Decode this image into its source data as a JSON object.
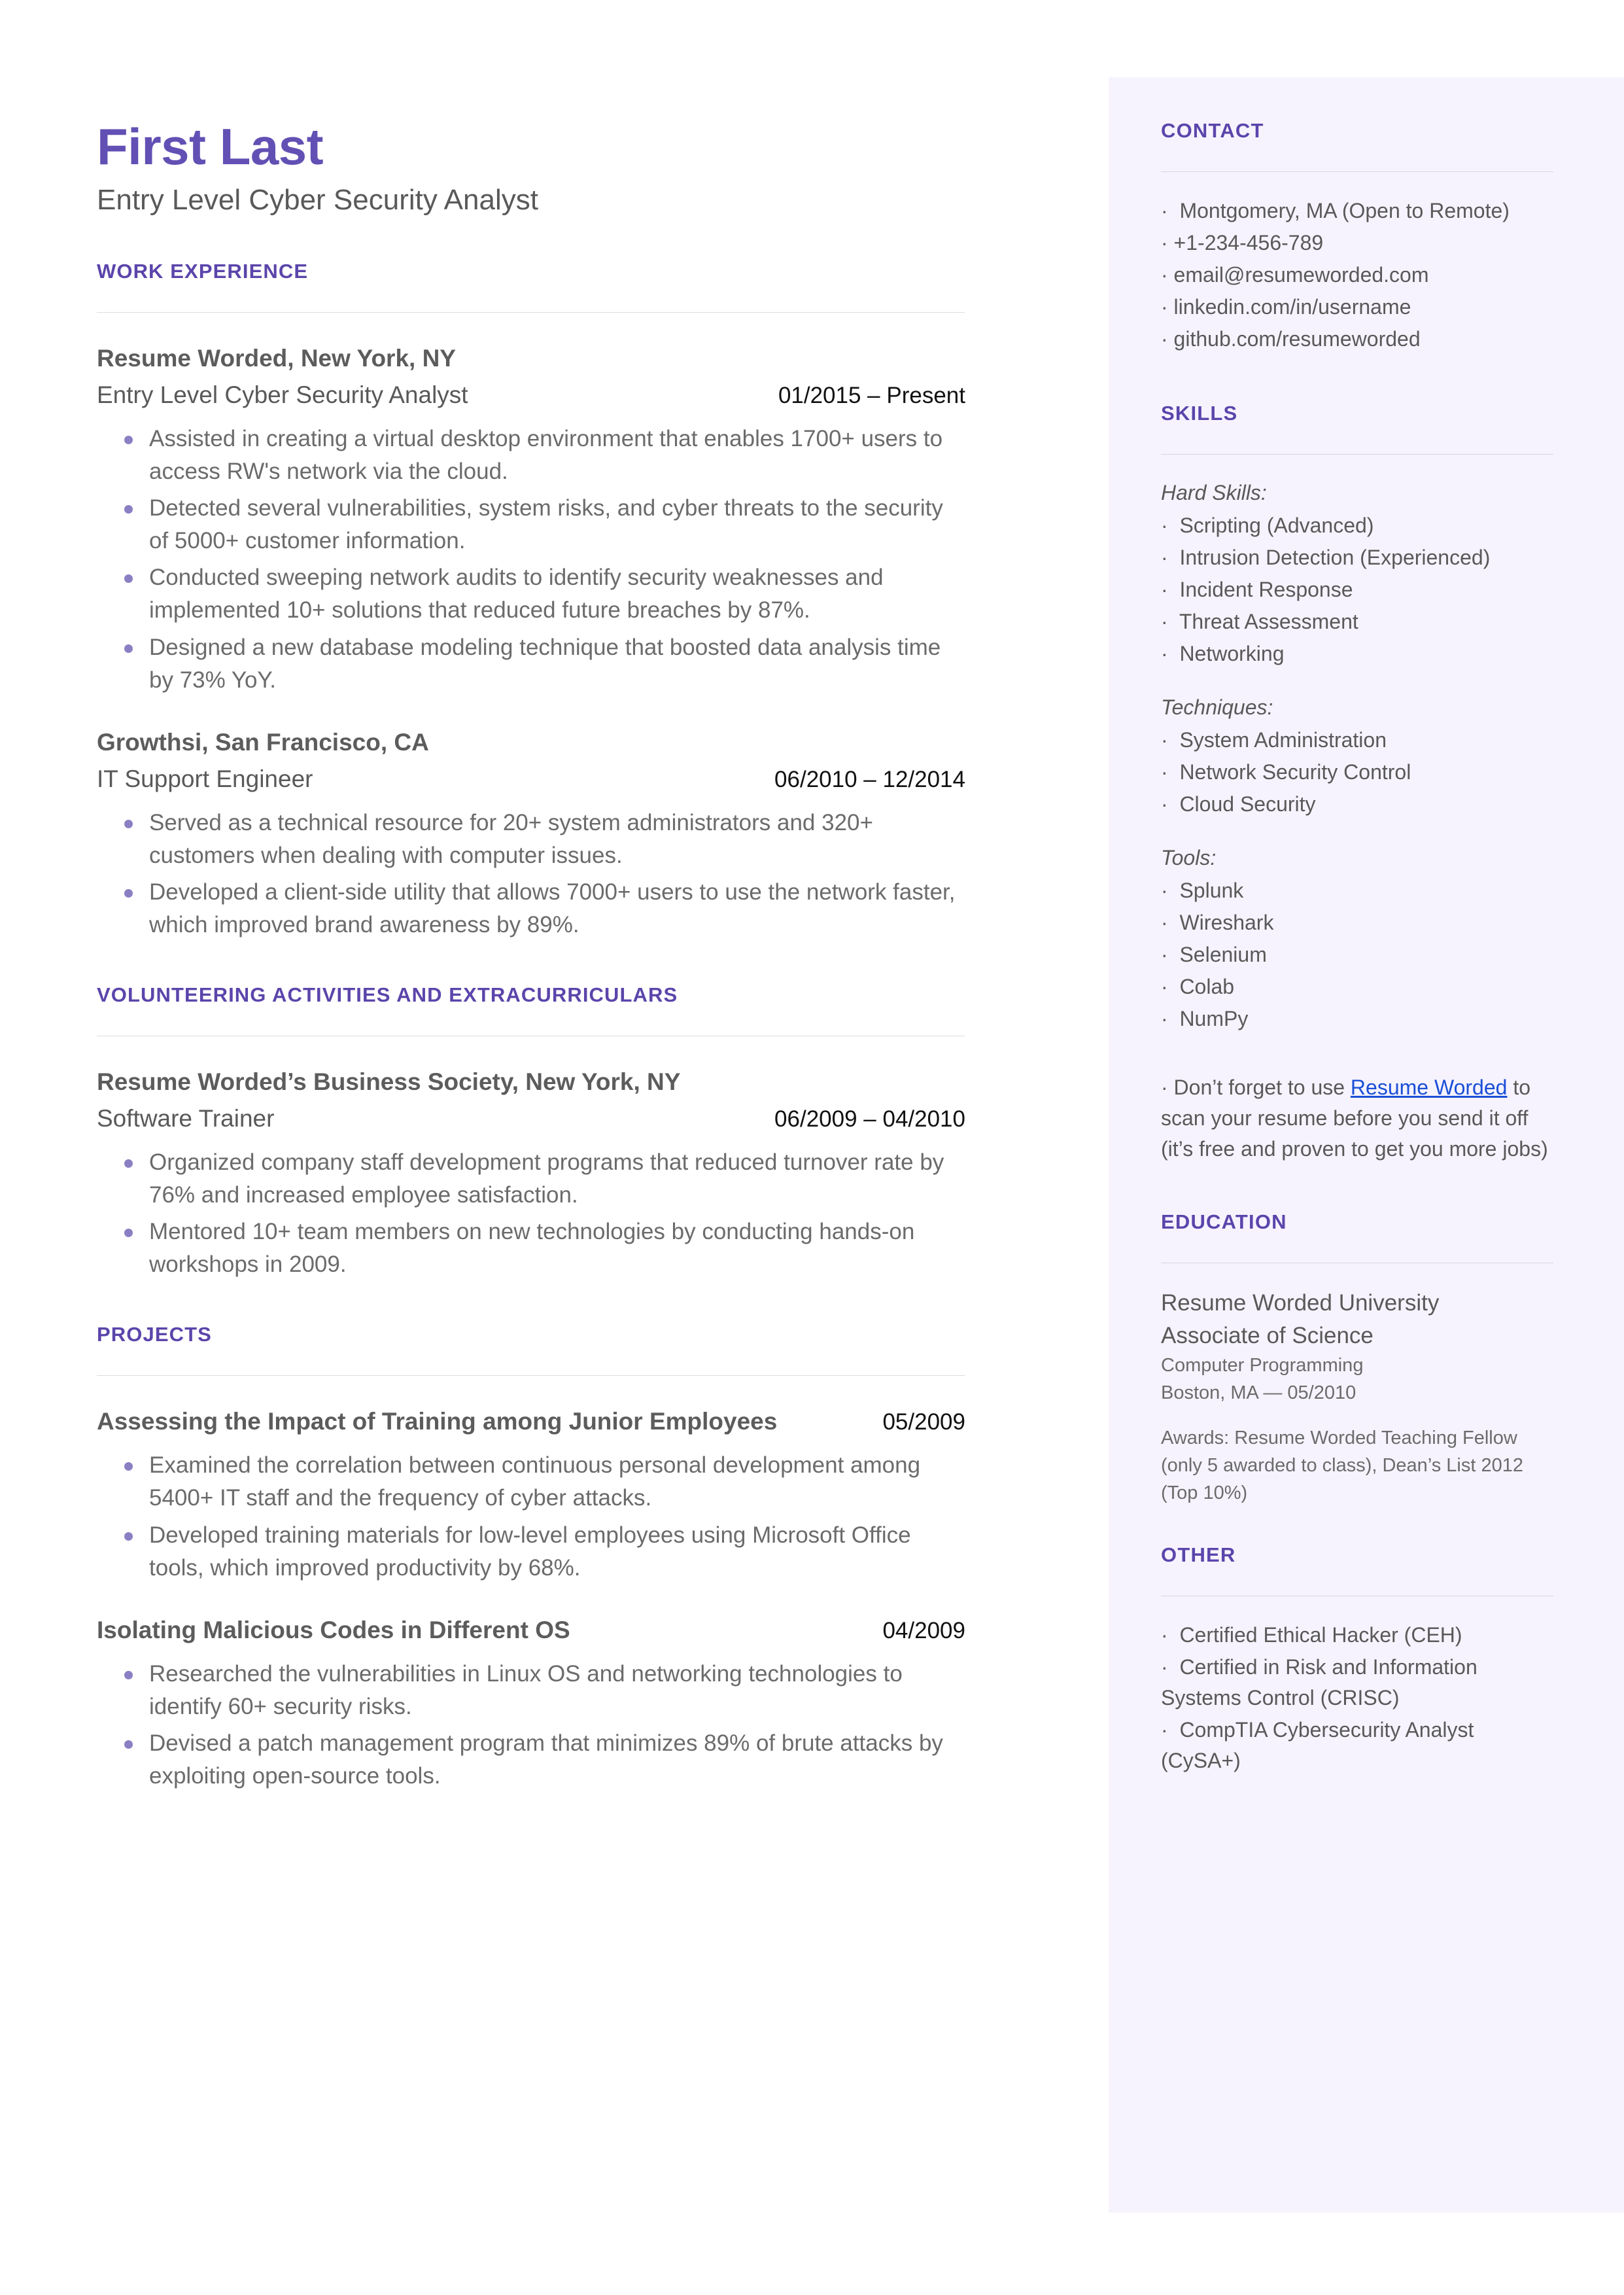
{
  "header": {
    "name": "First Last",
    "subtitle": "Entry Level Cyber Security Analyst"
  },
  "main": {
    "work": {
      "heading": "WORK EXPERIENCE",
      "entries": [
        {
          "org": "Resume Worded, New York, NY",
          "title": "Entry Level Cyber Security Analyst",
          "date": "01/2015 – Present",
          "bullets": [
            "Assisted in creating a virtual desktop environment that enables 1700+ users to access RW's network via the cloud.",
            "Detected several vulnerabilities, system risks, and cyber threats to the security of 5000+ customer information.",
            "Conducted sweeping network audits to identify security weaknesses and implemented 10+ solutions that reduced future breaches by 87%.",
            "Designed a new database modeling technique that boosted data analysis time by 73% YoY."
          ]
        },
        {
          "org": "Growthsi, San Francisco, CA",
          "title": "IT Support Engineer",
          "date": "06/2010 – 12/2014",
          "bullets": [
            "Served as a technical resource for 20+ system administrators and 320+ customers when dealing with computer issues.",
            "Developed a client-side utility that allows 7000+ users to use the network faster, which improved brand awareness by 89%."
          ]
        }
      ]
    },
    "volunteering": {
      "heading": "VOLUNTEERING ACTIVITIES AND EXTRACURRICULARS",
      "entries": [
        {
          "org": "Resume Worded’s Business Society, New York, NY",
          "title": "Software Trainer",
          "date": "06/2009 – 04/2010",
          "bullets": [
            "Organized company staff development programs that reduced turnover rate by 76% and increased employee satisfaction.",
            "Mentored 10+ team members on new technologies by conducting hands-on workshops in 2009."
          ]
        }
      ]
    },
    "projects": {
      "heading": "PROJECTS",
      "entries": [
        {
          "title": "Assessing the Impact of Training among Junior Employees",
          "date": "05/2009",
          "bullets": [
            "Examined the correlation between continuous personal development among 5400+ IT staff and the frequency of cyber attacks.",
            "Developed training materials for low-level employees using Microsoft Office tools, which improved productivity by 68%."
          ]
        },
        {
          "title": "Isolating Malicious Codes in Different OS",
          "date": "04/2009",
          "bullets": [
            "Researched the vulnerabilities in Linux OS and networking technologies to identify 60+ security risks.",
            "Devised a patch management program that minimizes 89% of brute attacks by exploiting open-source tools."
          ]
        }
      ]
    }
  },
  "sidebar": {
    "contact": {
      "heading": "CONTACT",
      "items": [
        "Montgomery, MA (Open to Remote)",
        "+1-234-456-789",
        "email@resumeworded.com",
        "linkedin.com/in/username",
        "github.com/resumeworded"
      ]
    },
    "skills": {
      "heading": "SKILLS",
      "groups": [
        {
          "label": "Hard Skills:",
          "items": [
            "Scripting (Advanced)",
            "Intrusion Detection (Experienced)",
            "Incident Response",
            "Threat Assessment",
            "Networking"
          ]
        },
        {
          "label": "Techniques:",
          "items": [
            "System Administration",
            "Network Security Control",
            "Cloud Security"
          ]
        },
        {
          "label": "Tools:",
          "items": [
            "Splunk",
            "Wireshark",
            "Selenium",
            "Colab",
            "NumPy"
          ]
        }
      ],
      "promo": {
        "before": "Don’t forget to use ",
        "link": "Resume Worded",
        "after": " to scan your resume before you send it off (it’s free and proven to get you more jobs)"
      }
    },
    "education": {
      "heading": "EDUCATION",
      "school": "Resume Worded University",
      "degree": "Associate of Science",
      "field": "Computer Programming",
      "location_date": "Boston, MA — 05/2010",
      "awards": "Awards: Resume Worded Teaching Fellow (only 5 awarded to class), Dean’s List 2012 (Top 10%)"
    },
    "other": {
      "heading": "OTHER",
      "items": [
        "Certified Ethical Hacker (CEH)",
        "Certified in Risk and Information Systems Control (CRISC)",
        "CompTIA Cybersecurity Analyst (CySA+)"
      ]
    }
  },
  "colors": {
    "accent": "#5b45ab",
    "name": "#6250b4",
    "sidebar_bg": "#f6f3fe",
    "link": "#1a4fd6",
    "bullet": "#8b7fc4"
  }
}
